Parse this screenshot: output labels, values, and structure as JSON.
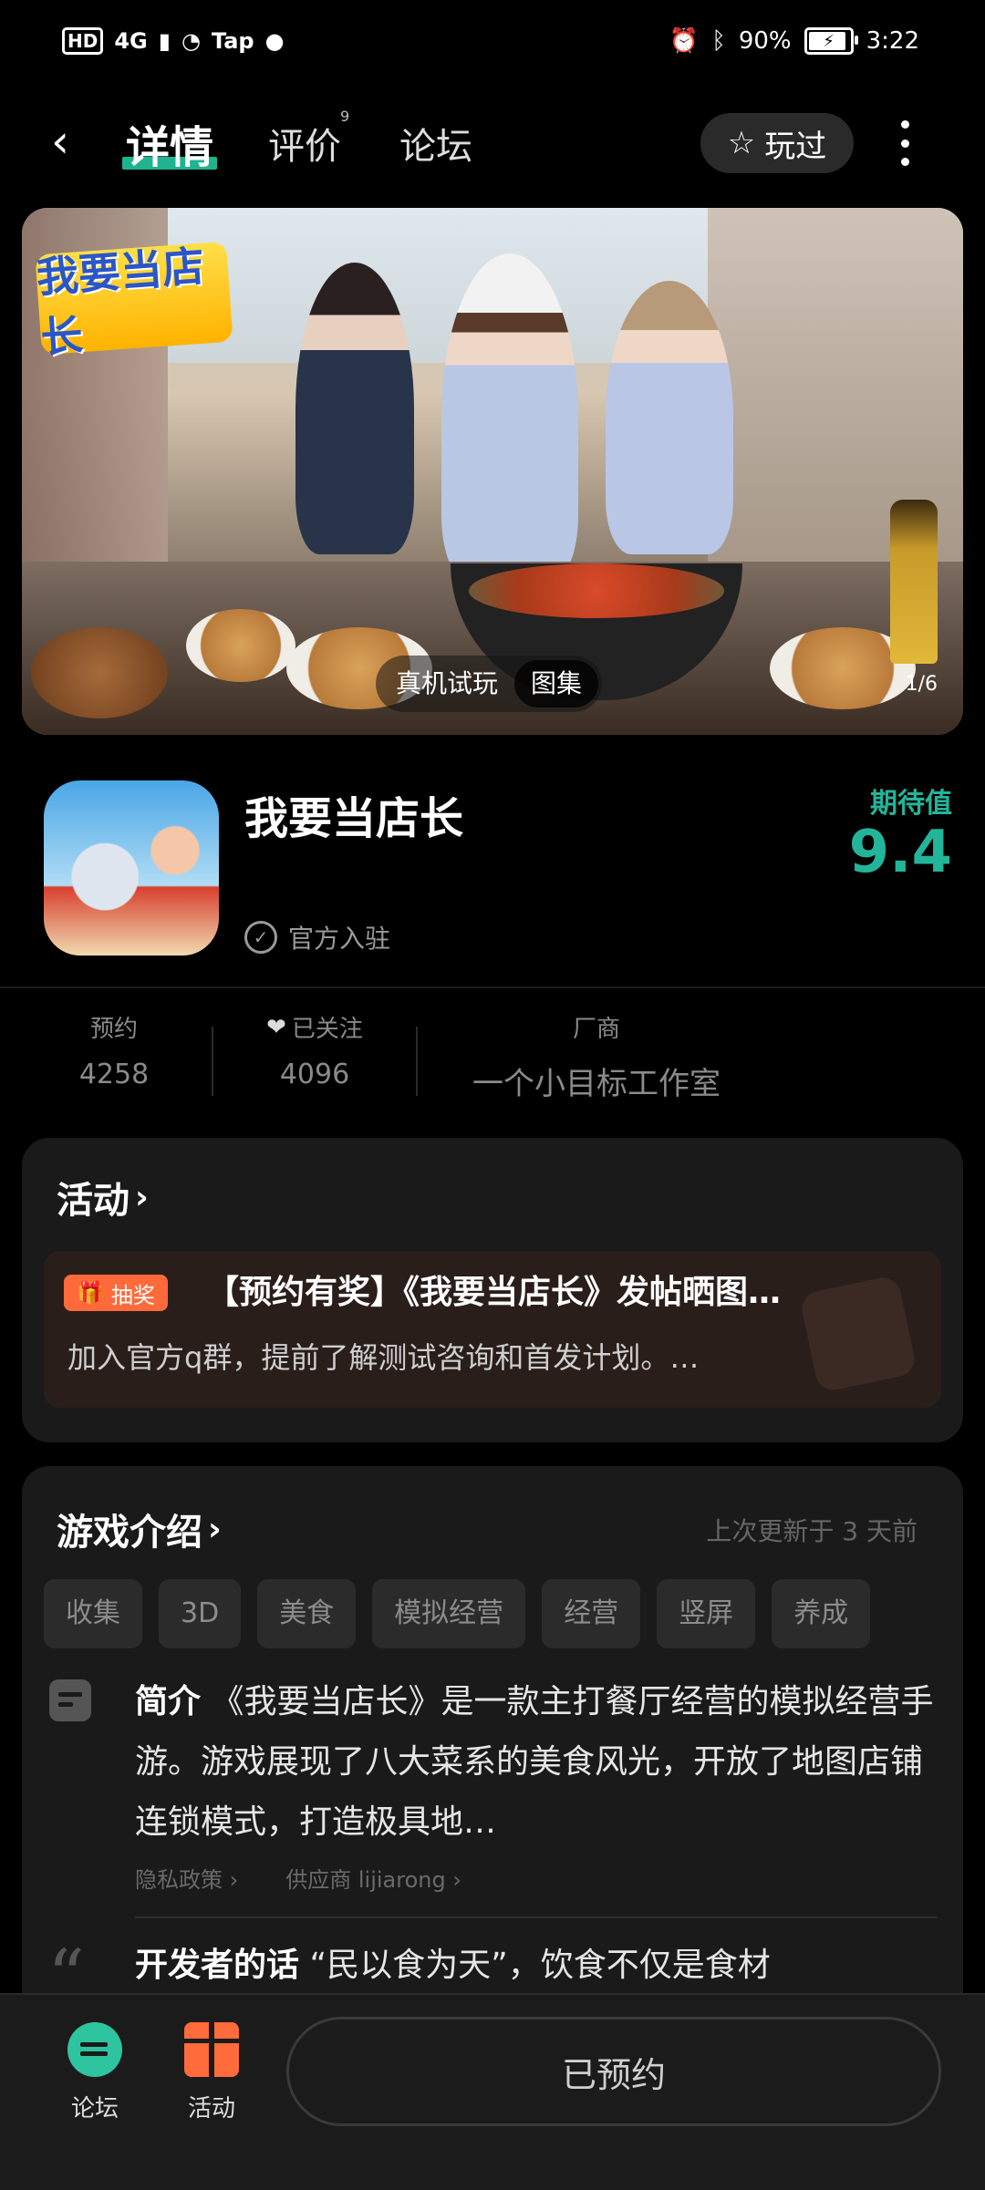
{
  "status_bar": {
    "hd": "HD",
    "network": "4G",
    "tap": "Tap",
    "battery_percent": "90%",
    "time": "3:22",
    "icons": [
      "alarm-icon",
      "bluetooth-icon",
      "battery-icon",
      "wechat-icon",
      "wifi-icon",
      "signal-icon"
    ]
  },
  "nav": {
    "back_icon": "chevron-left-icon",
    "tabs": [
      {
        "label": "详情",
        "active": true
      },
      {
        "label": "评价",
        "badge": "9"
      },
      {
        "label": "论坛"
      }
    ],
    "played_label": "玩过",
    "more_icon": "more-vertical-icon"
  },
  "hero": {
    "logo_text": "我要当店长",
    "pills": [
      "真机试玩",
      "图集"
    ],
    "active_pill": "图集",
    "counter": "1/6"
  },
  "app": {
    "name": "我要当店长",
    "verified_label": "官方入驻",
    "expect_label": "期待值",
    "expect_score": "9.4"
  },
  "stats": [
    {
      "label": "预约",
      "value": "4258"
    },
    {
      "label": "已关注",
      "value": "4096"
    },
    {
      "label": "厂商",
      "value": "一个小目标工作室"
    }
  ],
  "activity": {
    "title": "活动",
    "tag": "抽奖",
    "item_title": "【预约有奖】《我要当店长》发帖晒图…",
    "item_desc": "加入官方q群，提前了解测试咨询和首发计划。…"
  },
  "intro": {
    "title": "游戏介绍",
    "update_text": "上次更新于 3 天前",
    "tags": [
      "收集",
      "3D",
      "美食",
      "模拟经营",
      "经营",
      "竖屏",
      "养成"
    ],
    "summary_label": "简介",
    "summary_text": "《我要当店长》是一款主打餐厅经营的模拟经营手游。游戏展现了八大菜系的美食风光，开放了地图店铺连锁模式，打造极具地…",
    "privacy_link": "隐私政策",
    "supplier_link": "供应商 lijiarong",
    "dev_label": "开发者的话",
    "dev_text": "“民以食为天”，饮食不仅是食材"
  },
  "bottom": {
    "forum_label": "论坛",
    "activity_label": "活动",
    "reserved_label": "已预约"
  },
  "colors": {
    "accent": "#1fb38f",
    "score": "#23b59a",
    "lottery": "#ff6a3a"
  }
}
